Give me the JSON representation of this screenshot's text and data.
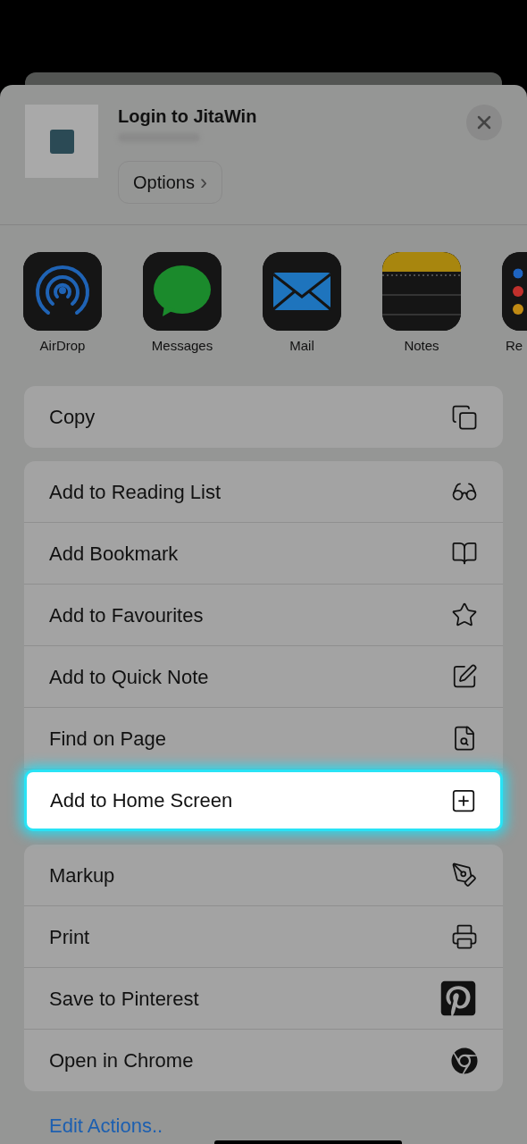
{
  "header": {
    "title": "Login to JitaWin",
    "options_button": "Options",
    "options_chevron": "›"
  },
  "apps": [
    {
      "kind": "airdrop",
      "label": "AirDrop"
    },
    {
      "kind": "messages",
      "label": "Messages"
    },
    {
      "kind": "mail",
      "label": "Mail"
    },
    {
      "kind": "notes",
      "label": "Notes"
    },
    {
      "kind": "reminders",
      "label": "Re"
    }
  ],
  "action_groups": [
    [
      {
        "label": "Copy",
        "kind": "copy",
        "selected": false
      }
    ],
    [
      {
        "label": "Add to Reading List",
        "kind": "glasses",
        "selected": false
      },
      {
        "label": "Add Bookmark",
        "kind": "book",
        "selected": false
      },
      {
        "label": "Add to Favourites",
        "kind": "star",
        "selected": false
      },
      {
        "label": "Add to Quick Note",
        "kind": "quicknote",
        "selected": false
      },
      {
        "label": "Find on Page",
        "kind": "findpage",
        "selected": false
      },
      {
        "label": "Add to Home Screen",
        "kind": "addsquare",
        "selected": true
      }
    ],
    [
      {
        "label": "Markup",
        "kind": "markup",
        "selected": false
      },
      {
        "label": "Print",
        "kind": "print",
        "selected": false
      },
      {
        "label": "Save to Pinterest",
        "kind": "pinterest",
        "selected": false
      },
      {
        "label": "Open in Chrome",
        "kind": "chrome",
        "selected": false
      }
    ]
  ],
  "edit_actions": "Edit Actions.."
}
